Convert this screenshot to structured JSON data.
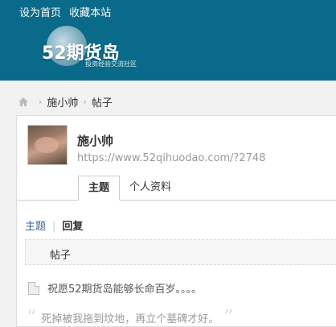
{
  "top_links": {
    "set_home": "设为首页",
    "bookmark": "收藏本站"
  },
  "logo": {
    "text": "52期货岛",
    "subtitle": "投资经验交流社区"
  },
  "breadcrumb": {
    "user": "施小帅",
    "section": "帖子"
  },
  "profile": {
    "name": "施小帅",
    "url": "https://www.52qihuodao.com/?2748",
    "tabs": [
      "主题",
      "个人资料"
    ]
  },
  "subnav": {
    "topics": "主题",
    "replies": "回复"
  },
  "thread": {
    "title": "帖子"
  },
  "reply": {
    "text": "祝愿52期货岛能够长命百岁。。。。"
  },
  "quote": {
    "open": "“",
    "text": "死掉被我拖到坟地，再立个墓碑才好。",
    "close": "”"
  },
  "colors": {
    "header_bg": "#0a6a8a",
    "link": "#336699"
  }
}
